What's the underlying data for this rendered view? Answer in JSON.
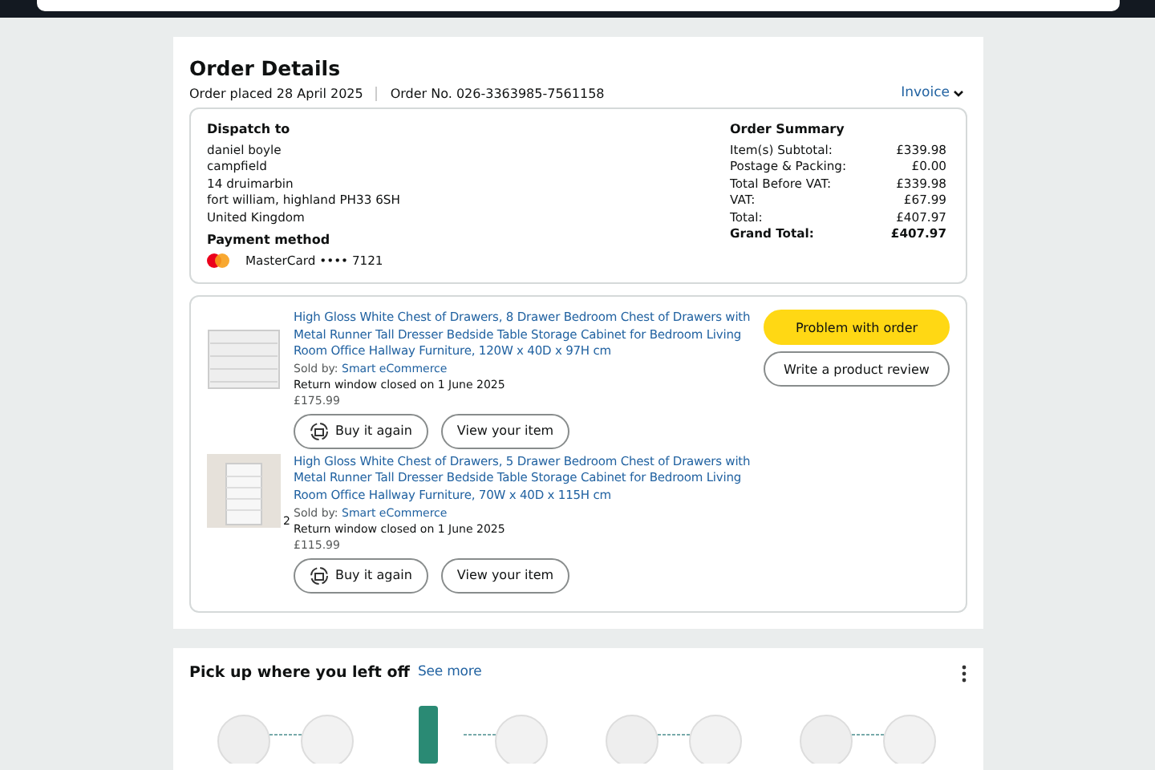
{
  "order": {
    "title": "Order Details",
    "placed": "Order placed 28 April 2025",
    "number": "Order No. 026-3363985-7561158",
    "invoice": "Invoice",
    "dispatch": {
      "heading": "Dispatch to",
      "lines": [
        "daniel boyle",
        "campfield",
        "14 druimarbin",
        "fort william, highland PH33 6SH",
        "United Kingdom"
      ]
    },
    "payment": {
      "heading": "Payment method",
      "card": "MasterCard •••• 7121"
    },
    "summary": {
      "heading": "Order Summary",
      "rows": [
        {
          "label": "Item(s) Subtotal:",
          "value": "£339.98",
          "bold": false
        },
        {
          "label": "Postage & Packing:",
          "value": "£0.00",
          "bold": false
        },
        {
          "label": "Total Before VAT:",
          "value": "£339.98",
          "bold": false
        },
        {
          "label": "VAT:",
          "value": "£67.99",
          "bold": false
        },
        {
          "label": "Total:",
          "value": "£407.97",
          "bold": false
        },
        {
          "label": "Grand Total:",
          "value": "£407.97",
          "bold": true
        }
      ]
    },
    "items": [
      {
        "kind": "wide",
        "title": "High Gloss White Chest of Drawers, 8 Drawer Bedroom Chest of Drawers with Metal Runner Tall Dresser Bedside Table Storage Cabinet for Bedroom Living Room Office Hallway Furniture, 120W x 40D x 97H cm",
        "sold_by": "Sold by:",
        "seller": "Smart eCommerce",
        "return": "Return window closed on 1 June 2025",
        "price": "£175.99",
        "buttons": [
          "Buy it again",
          "View your item"
        ]
      },
      {
        "kind": "tall",
        "quantity": "2",
        "title": "High Gloss White Chest of Drawers, 5 Drawer Bedroom Chest of Drawers with Metal Runner Tall Dresser Bedside Table Storage Cabinet for Bedroom Living Room Office Hallway Furniture, 70W x 40D x 115H cm",
        "sold_by": "Sold by:",
        "seller": "Smart eCommerce",
        "return": "Return window closed on 1 June 2025",
        "price": "£115.99",
        "buttons": [
          "Buy it again",
          "View your item"
        ]
      }
    ],
    "actions": [
      {
        "label": "Problem with order",
        "kind": "primary"
      },
      {
        "label": "Write a product review",
        "kind": "secondary"
      }
    ]
  },
  "recommendations": {
    "title": "Pick up where you left off",
    "link": "See more",
    "products": [
      {
        "kind": "pair"
      },
      {
        "kind": "phone"
      },
      {
        "kind": "pair"
      },
      {
        "kind": "pair"
      }
    ]
  }
}
